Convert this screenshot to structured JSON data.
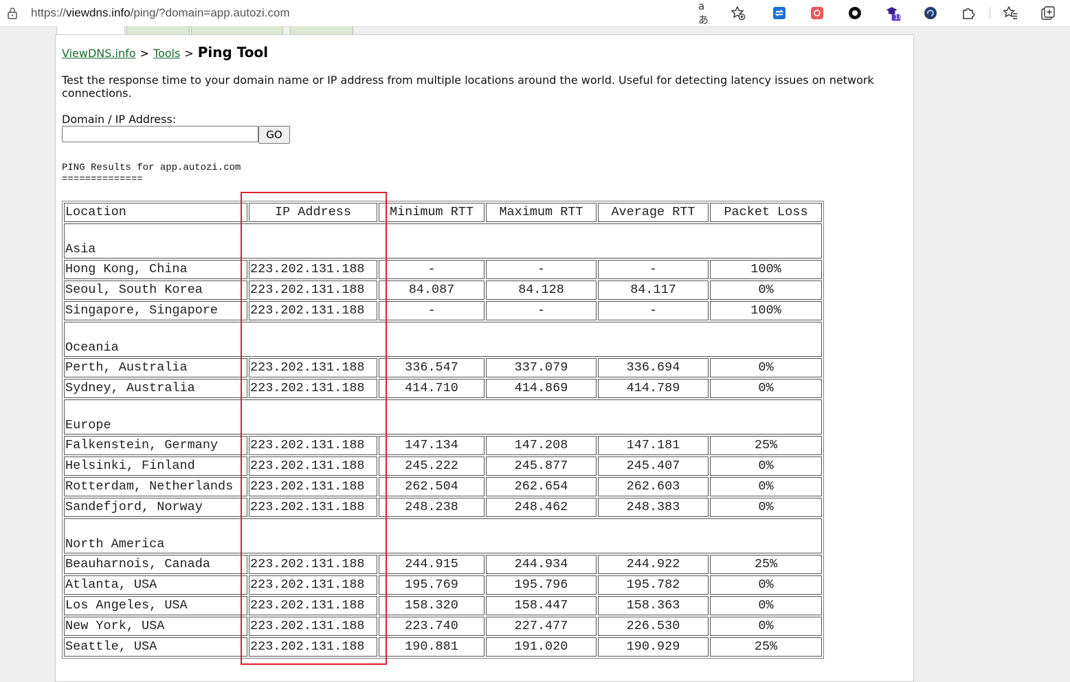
{
  "browser": {
    "url_prefix": "https://",
    "url_host": "viewdns.info",
    "url_path": "/ping/?domain=app.autozi.com",
    "read_aloud_glyph": "aあ",
    "extension_badge": "10"
  },
  "breadcrumb": {
    "home": "ViewDNS.info",
    "tools": "Tools",
    "sep": ">",
    "current": "Ping Tool"
  },
  "description": "Test the response time to your domain name or IP address from multiple locations around the world. Useful for detecting latency issues on network connections.",
  "form": {
    "label": "Domain / IP Address:",
    "value": "",
    "button": "GO"
  },
  "results": {
    "title": "PING Results for app.autozi.com",
    "underline": "=============="
  },
  "table": {
    "headers": [
      "Location",
      "IP Address",
      "Minimum RTT",
      "Maximum RTT",
      "Average RTT",
      "Packet Loss"
    ],
    "regions": [
      {
        "name": "Asia",
        "rows": [
          [
            "Hong Kong, China",
            "223.202.131.188",
            "-",
            "-",
            "-",
            "100%"
          ],
          [
            "Seoul, South Korea",
            "223.202.131.188",
            "84.087",
            "84.128",
            "84.117",
            "0%"
          ],
          [
            "Singapore, Singapore",
            "223.202.131.188",
            "-",
            "-",
            "-",
            "100%"
          ]
        ]
      },
      {
        "name": "Oceania",
        "rows": [
          [
            "Perth, Australia",
            "223.202.131.188",
            "336.547",
            "337.079",
            "336.694",
            "0%"
          ],
          [
            "Sydney, Australia",
            "223.202.131.188",
            "414.710",
            "414.869",
            "414.789",
            "0%"
          ]
        ]
      },
      {
        "name": "Europe",
        "rows": [
          [
            "Falkenstein, Germany",
            "223.202.131.188",
            "147.134",
            "147.208",
            "147.181",
            "25%"
          ],
          [
            "Helsinki, Finland",
            "223.202.131.188",
            "245.222",
            "245.877",
            "245.407",
            "0%"
          ],
          [
            "Rotterdam, Netherlands",
            "223.202.131.188",
            "262.504",
            "262.654",
            "262.603",
            "0%"
          ],
          [
            "Sandefjord, Norway",
            "223.202.131.188",
            "248.238",
            "248.462",
            "248.383",
            "0%"
          ]
        ]
      },
      {
        "name": "North America",
        "rows": [
          [
            "Beauharnois, Canada",
            "223.202.131.188",
            "244.915",
            "244.934",
            "244.922",
            "25%"
          ],
          [
            "Atlanta, USA",
            "223.202.131.188",
            "195.769",
            "195.796",
            "195.782",
            "0%"
          ],
          [
            "Los Angeles, USA",
            "223.202.131.188",
            "158.320",
            "158.447",
            "158.363",
            "0%"
          ],
          [
            "New York, USA",
            "223.202.131.188",
            "223.740",
            "227.477",
            "226.530",
            "0%"
          ],
          [
            "Seattle, USA",
            "223.202.131.188",
            "190.881",
            "191.020",
            "190.929",
            "25%"
          ]
        ]
      }
    ]
  },
  "colors": {
    "link": "#176b2e",
    "highlight_box": "#e0202a",
    "tab_bg": "#dde8d4"
  }
}
